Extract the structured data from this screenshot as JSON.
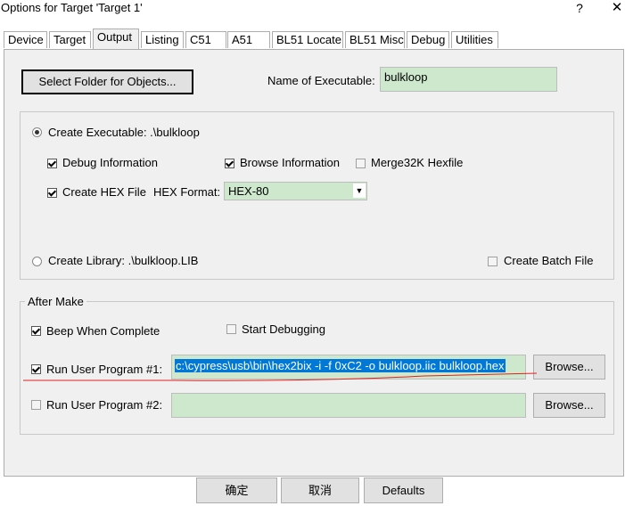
{
  "window": {
    "title": "Options for Target 'Target 1'",
    "help_glyph": "?",
    "close_glyph": "✕"
  },
  "tabs": [
    {
      "label": "Device"
    },
    {
      "label": "Target"
    },
    {
      "label": "Output"
    },
    {
      "label": "Listing"
    },
    {
      "label": "C51"
    },
    {
      "label": "A51"
    },
    {
      "label": "BL51 Locate"
    },
    {
      "label": "BL51 Misc"
    },
    {
      "label": "Debug"
    },
    {
      "label": "Utilities"
    }
  ],
  "active_tab": "Output",
  "top": {
    "select_folder_label": "Select Folder for Objects...",
    "name_exe_label": "Name of Executable:",
    "name_exe_value": "bulkloop"
  },
  "output": {
    "create_exe_label": "Create Executable:  .\\bulkloop",
    "debug_info_label": "Debug Information",
    "browse_info_label": "Browse Information",
    "merge32k_label": "Merge32K Hexfile",
    "create_hex_label": "Create HEX File",
    "hex_format_label": "HEX Format:",
    "hex_format_value": "HEX-80",
    "create_lib_label": "Create Library:  .\\bulkloop.LIB",
    "create_batch_label": "Create Batch File"
  },
  "after_make": {
    "group_label": "After Make",
    "beep_label": "Beep When Complete",
    "start_debug_label": "Start Debugging",
    "run1_label": "Run User Program #1:",
    "run1_value": "c:\\cypress\\usb\\bin\\hex2bix -i -f 0xC2 -o bulkloop.iic bulkloop.hex",
    "run2_label": "Run User Program #2:",
    "run2_value": "",
    "browse_label": "Browse..."
  },
  "footer": {
    "ok_label": "确定",
    "cancel_label": "取消",
    "defaults_label": "Defaults"
  },
  "colors": {
    "field_bg": "#cde8cc",
    "selection": "#0078d7",
    "annotation_line": "#e02020"
  }
}
